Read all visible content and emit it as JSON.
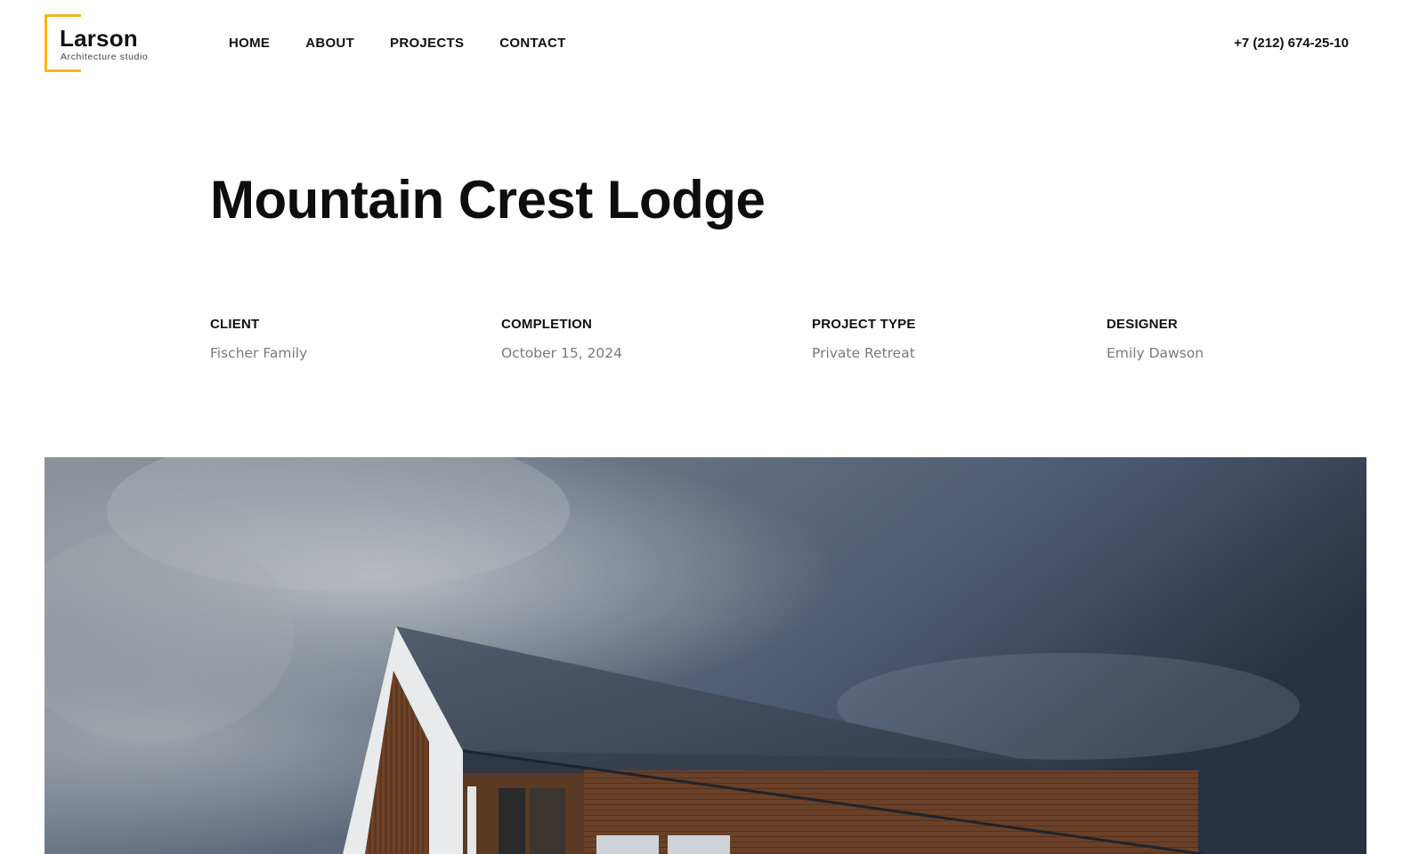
{
  "brand": {
    "name": "Larson",
    "tagline": "Architecture studio",
    "accent_color": "#f1b81b"
  },
  "nav": {
    "items": [
      "HOME",
      "ABOUT",
      "PROJECTS",
      "CONTACT"
    ]
  },
  "phone": "+7 (212) 674-25-10",
  "project": {
    "title": "Mountain Crest Lodge",
    "details": [
      {
        "label": "CLIENT",
        "value": "Fischer Family"
      },
      {
        "label": "COMPLETION",
        "value": "October 15, 2024"
      },
      {
        "label": "PROJECT TYPE",
        "value": "Private Retreat"
      },
      {
        "label": "DESIGNER",
        "value": "Emily Dawson"
      }
    ]
  },
  "hero_image": {
    "subject": "timber lodge with slate roof under cloudy sky"
  }
}
